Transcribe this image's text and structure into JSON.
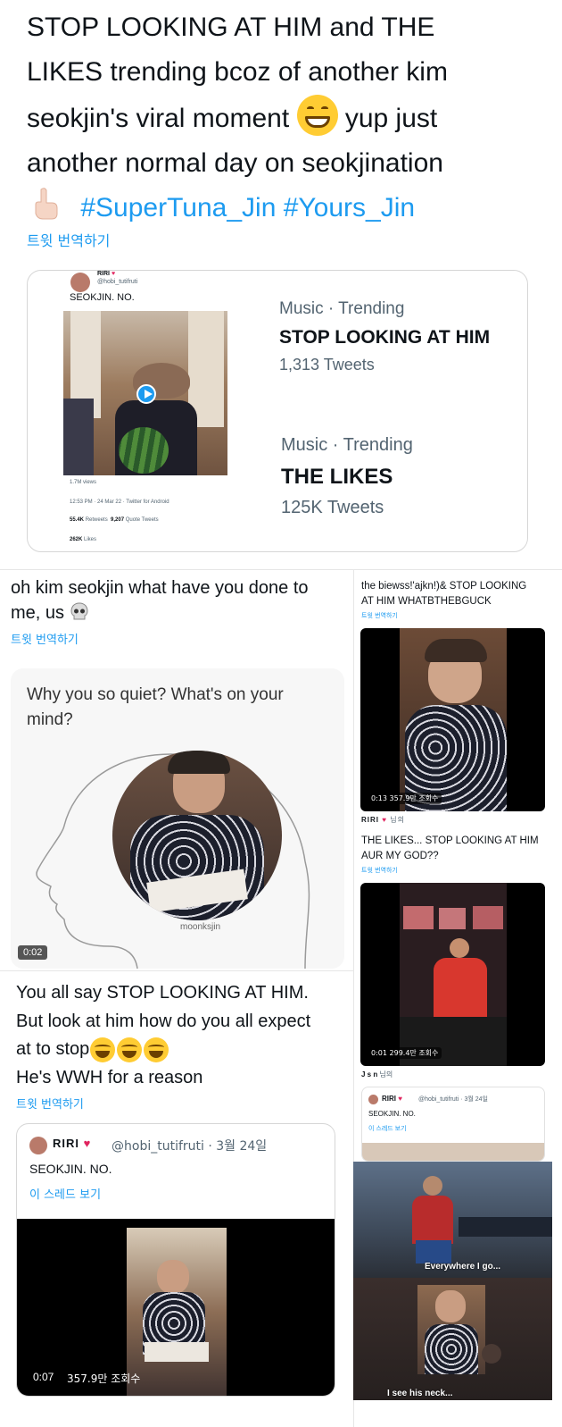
{
  "top_tweet": {
    "line1": "STOP LOOKING AT HIM and THE",
    "line2": "LIKES trending bcoz of another kim",
    "line3a": "seokjin's viral moment ",
    "line3b": " yup just",
    "line4": "another normal day on seokjination",
    "hashtags": "#SuperTuna_Jin #Yours_Jin",
    "translate": "트윗 번역하기"
  },
  "embed_card": {
    "author_name": "RIRI",
    "handle": "@hobi_tutifruti",
    "text": "SEOKJIN. NO.",
    "views": "1.7M views",
    "meta": "12:53 PM · 24 Mar 22 · Twitter for Android",
    "retweets_num": "55.4K",
    "retweets_label": "Retweets",
    "quotes_num": "9,207",
    "quotes_label": "Quote Tweets",
    "likes_num": "262K",
    "likes_label": "Likes",
    "trend1": {
      "category": "Music · Trending",
      "title": "STOP LOOKING AT HIM",
      "count": "1,313 Tweets"
    },
    "trend2": {
      "category": "Music · Trending",
      "title": "THE LIKES",
      "count": "125K Tweets"
    }
  },
  "left_tweet_1": {
    "text_line1": "oh kim seokjin what have you done to",
    "text_line2": "me, us",
    "translate": "트윗 번역하기",
    "meme_text_line1": "Why you so quiet? What's on your",
    "meme_text_line2": "mind?",
    "watermark": "moonksjin",
    "duration": "0:02"
  },
  "left_tweet_2": {
    "line1": "You all say STOP LOOKING AT HIM.",
    "line2": "But look at him how do you all expect",
    "line3": "at to stop",
    "line4": "He's WWH for a reason",
    "translate": "트윗 번역하기",
    "quote_author": "RIRI",
    "quote_handle": "@hobi_tutifruti · 3월 24일",
    "quote_text": "SEOKJIN. NO.",
    "quote_thread": "이 스레드 보기",
    "video_time": "0:07",
    "video_views": "357.9만 조회수"
  },
  "right_tweet_1": {
    "line1": "the biewss!'ajkn!)& STOP LOOKING",
    "line2": "AT HIM WHATBTHEBGUCK",
    "translate": "트윗 번역하기",
    "video_badge": "0:13  357.9만 조회수",
    "author": "RIRI",
    "author_suffix": "님의"
  },
  "right_tweet_2": {
    "line1": "THE LIKES... STOP LOOKING AT HIM",
    "line2": "AUR MY GOD??",
    "translate": "트윗 번역하기",
    "video_badge": "0:01  299.4만 조회수",
    "author": "J s n",
    "author_suffix": "님의"
  },
  "right_tweet_3": {
    "author": "RIRI",
    "handle": "@hobi_tutifruti · 3월 24일",
    "text": "SEOKJIN. NO.",
    "thread": "이 스레드 보기",
    "caption1": "Everywhere I go...",
    "caption2": "I see his neck..."
  }
}
